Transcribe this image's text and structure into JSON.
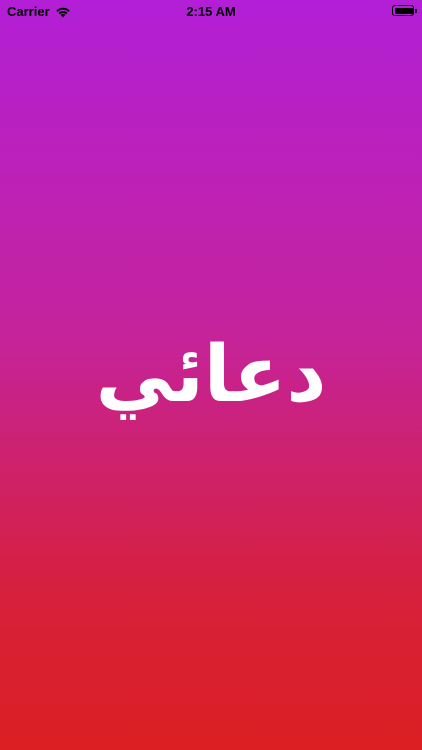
{
  "status_bar": {
    "carrier": "Carrier",
    "time": "2:15 AM",
    "battery_level": 0.9
  },
  "splash": {
    "logo_text": "دعائي"
  },
  "colors": {
    "gradient_top": "#B21FD6",
    "gradient_bottom": "#DB1F22",
    "logo_color": "#FFFFFF"
  },
  "icons": {
    "wifi": "wifi-icon",
    "battery": "battery-icon"
  }
}
